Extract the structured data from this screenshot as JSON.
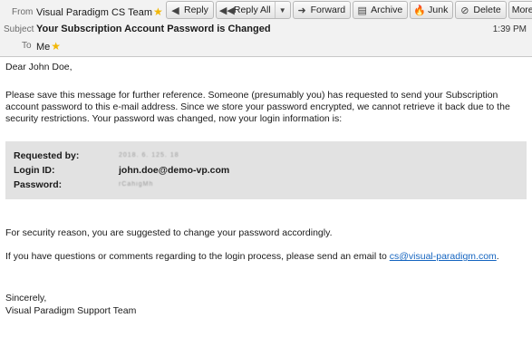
{
  "header": {
    "from_label": "From",
    "from_value": "Visual Paradigm CS Team",
    "subject_label": "Subject",
    "subject_value": "Your Subscription Account Password is Changed",
    "to_label": "To",
    "to_value": "Me",
    "time": "1:39 PM"
  },
  "toolbar": {
    "reply": "Reply",
    "reply_all": "Reply All",
    "forward": "Forward",
    "archive": "Archive",
    "junk": "Junk",
    "delete": "Delete",
    "more": "More"
  },
  "message": {
    "greeting": "Dear John Doe,",
    "para1": "Please save this message for further reference. Someone (presumably you) has requested to send your Subscription account password to this e-mail address. Since we store your password encrypted, we cannot retrieve it back due to the security restrictions. Your password was changed, now your login information is:",
    "requested_by_label": "Requested by:",
    "requested_by_value": "2018. 6. 125. 18",
    "login_id_label": "Login ID:",
    "login_id_value": "john.doe@demo-vp.com",
    "password_label": "Password:",
    "password_value": "rCahigMh",
    "security_note": "For security reason, you are suggested to change your password accordingly.",
    "questions_prefix": "If you have questions or comments regarding to the login process, please send an email to ",
    "questions_email": "cs@visual-paradigm.com",
    "questions_suffix": ".",
    "closing": "Sincerely,",
    "signature": "Visual Paradigm Support Team"
  }
}
